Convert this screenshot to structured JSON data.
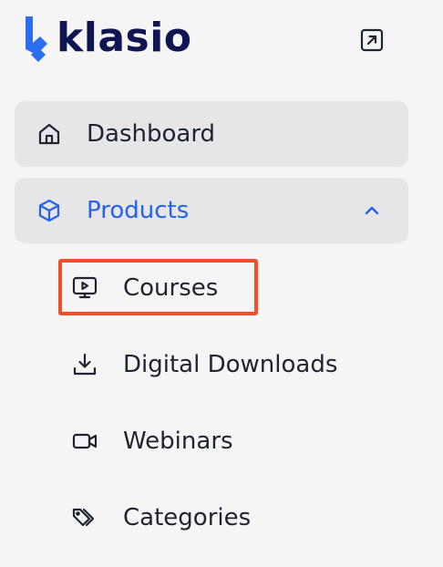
{
  "brand": {
    "name": "klasio",
    "icon": "klasio-logo-icon"
  },
  "header": {
    "collapse_icon": "collapse-sidebar-icon"
  },
  "colors": {
    "brand_navy": "#0e1550",
    "accent_blue": "#2563eb",
    "highlight": "#f24e2a",
    "item_bg": "#e6e6e9",
    "page_bg": "#f5f5f6"
  },
  "nav": {
    "dashboard": {
      "label": "Dashboard",
      "icon": "home-icon"
    },
    "products": {
      "label": "Products",
      "icon": "box-icon",
      "expanded": true,
      "toggle_icon": "chevron-up-icon",
      "children": [
        {
          "label": "Courses",
          "icon": "video-lesson-icon",
          "highlighted": true
        },
        {
          "label": "Digital Downloads",
          "icon": "download-icon"
        },
        {
          "label": "Webinars",
          "icon": "video-camera-icon"
        },
        {
          "label": "Categories",
          "icon": "tags-icon"
        }
      ]
    }
  }
}
